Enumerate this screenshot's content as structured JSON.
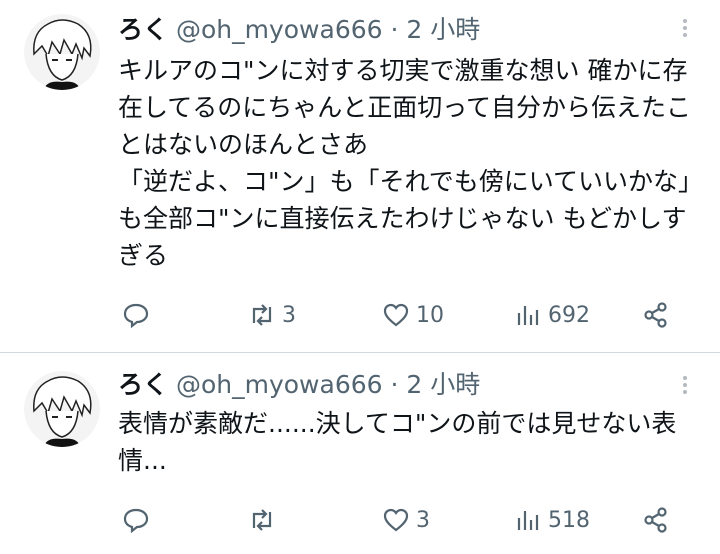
{
  "tweets": [
    {
      "name": "ろく",
      "handle": "@oh_myowa666",
      "separator": "·",
      "time": "2 小時",
      "text": "キルアのコ\"ンに対する切実で激重な想い 確かに存在してるのにちゃんと正面切って自分から伝えたことはないのほんとさあ\n「逆だよ、コ\"ン」も「それでも傍にいていいかな」も全部コ\"ンに直接伝えたわけじゃない もどかしすぎる",
      "replies": "",
      "retweets": "3",
      "likes": "10",
      "views": "692"
    },
    {
      "name": "ろく",
      "handle": "@oh_myowa666",
      "separator": "·",
      "time": "2 小時",
      "text": "表情が素敵だ......決してコ\"ンの前では見せない表情...",
      "replies": "",
      "retweets": "",
      "likes": "3",
      "views": "518"
    }
  ],
  "icons": {
    "reply": "reply-icon",
    "retweet": "retweet-icon",
    "like": "heart-icon",
    "views": "views-icon",
    "share": "share-icon",
    "more": "more-icon"
  },
  "colors": {
    "text": "#0f1419",
    "secondary": "#536471",
    "divider": "#cfd9de"
  }
}
